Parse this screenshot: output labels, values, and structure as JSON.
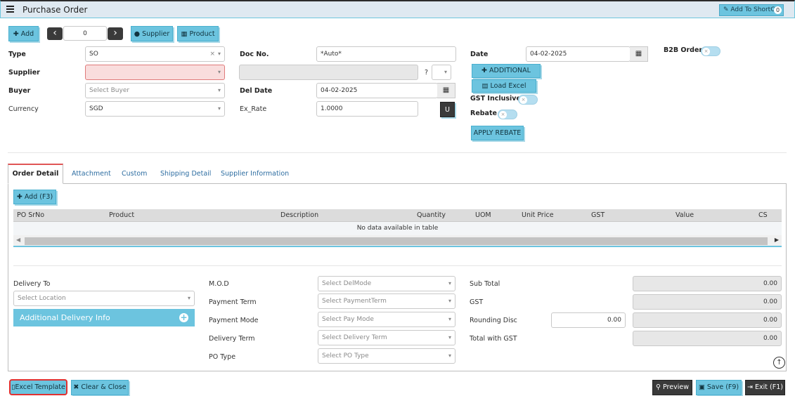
{
  "header": {
    "title": "Purchase Order",
    "shortcut_label": "Add To ShortCut",
    "shortcut_count": "0"
  },
  "toolbar": {
    "add_label": "Add",
    "record_index": "0",
    "prev_label": "‹",
    "next_label": "›",
    "supplier_label": "Supplier",
    "product_label": "Product"
  },
  "form": {
    "type_label": "Type",
    "type_value": "SO",
    "supplier_label": "Supplier",
    "supplier_value": "",
    "supplier_secondary_value": "",
    "question_mark": "?",
    "buyer_label": "Buyer",
    "buyer_placeholder": "Select Buyer",
    "currency_label": "Currency",
    "currency_value": "SGD",
    "docno_label": "Doc No.",
    "docno_value": "*Auto*",
    "deldate_label": "Del Date",
    "deldate_value": "04-02-2025",
    "exrate_label": "Ex_Rate",
    "exrate_value": "1.0000",
    "u_button": "U",
    "date_label": "Date",
    "date_value": "04-02-2025",
    "additional_label": "ADDITIONAL",
    "load_excel_label": "Load Excel",
    "gst_inclusive_label": "GST Inclusive",
    "rebate_label": "Rebate",
    "apply_rebate_label": "APPLY REBATE",
    "b2b_label": "B2B Order"
  },
  "tabs": [
    {
      "label": "Order Detail",
      "active": true
    },
    {
      "label": "Attachment",
      "active": false
    },
    {
      "label": "Custom",
      "active": false
    },
    {
      "label": "Shipping Detail",
      "active": false
    },
    {
      "label": "Supplier Information",
      "active": false
    }
  ],
  "grid": {
    "add_label": "Add (F3)",
    "columns": [
      "PO SrNo",
      "Product",
      "Description",
      "Quantity",
      "UOM",
      "Unit Price",
      "GST",
      "Value",
      "CS"
    ],
    "empty_message": "No data available in table"
  },
  "delivery": {
    "delivery_to_label": "Delivery To",
    "location_placeholder": "Select Location",
    "additional_info_label": "Additional Delivery Info",
    "mod_label": "M.O.D",
    "mod_placeholder": "Select DelMode",
    "payment_term_label": "Payment Term",
    "payment_term_placeholder": "Select PaymentTerm",
    "payment_mode_label": "Payment Mode",
    "payment_mode_placeholder": "Select Pay Mode",
    "delivery_term_label": "Delivery Term",
    "delivery_term_placeholder": "Select Delivery Term",
    "po_type_label": "PO Type",
    "po_type_placeholder": "Select PO Type"
  },
  "totals": {
    "sub_total_label": "Sub Total",
    "sub_total_value": "0.00",
    "gst_label": "GST",
    "gst_value": "0.00",
    "rounding_label": "Rounding Disc",
    "rounding_input": "0.00",
    "rounding_value": "0.00",
    "total_gst_label": "Total with GST",
    "total_gst_value": "0.00"
  },
  "footer": {
    "excel_template_label": "Excel Template",
    "clear_close_label": "Clear & Close",
    "preview_label": "Preview",
    "save_label": "Save (F9)",
    "exit_label": "Exit (F1)"
  },
  "colors": {
    "accent": "#6cc4df",
    "dark": "#3a3a3a",
    "error_bg": "#f9dddd",
    "highlight": "#e03030"
  }
}
